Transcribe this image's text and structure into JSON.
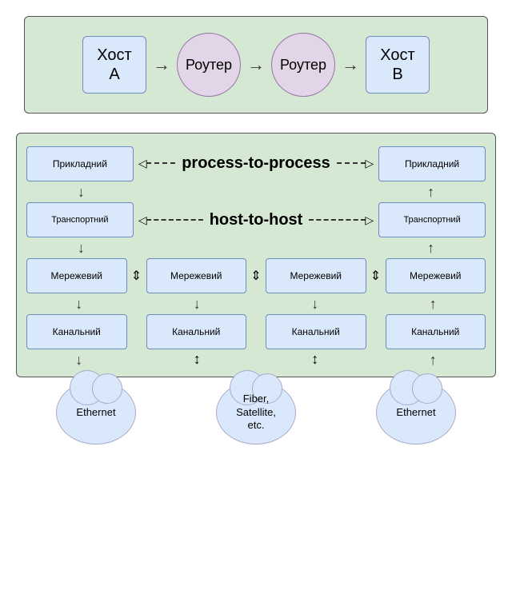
{
  "top_diagram": {
    "host_a": "Хост\nA",
    "router1": "Роутер",
    "router2": "Роутер",
    "host_b": "Хост\nB"
  },
  "bottom_diagram": {
    "process_to_process_label": "process-to-process",
    "host_to_host_label": "host-to-host",
    "layers": {
      "prykladnyi": "Прикладний",
      "transportnyi": "Транспортний",
      "merezhevyi": "Мережевий",
      "kanalnyi": "Канальний"
    }
  },
  "clouds": {
    "ethernet1": "Ethernet",
    "middle": "Fiber,\nSatellite,\netc.",
    "ethernet2": "Ethernet"
  }
}
